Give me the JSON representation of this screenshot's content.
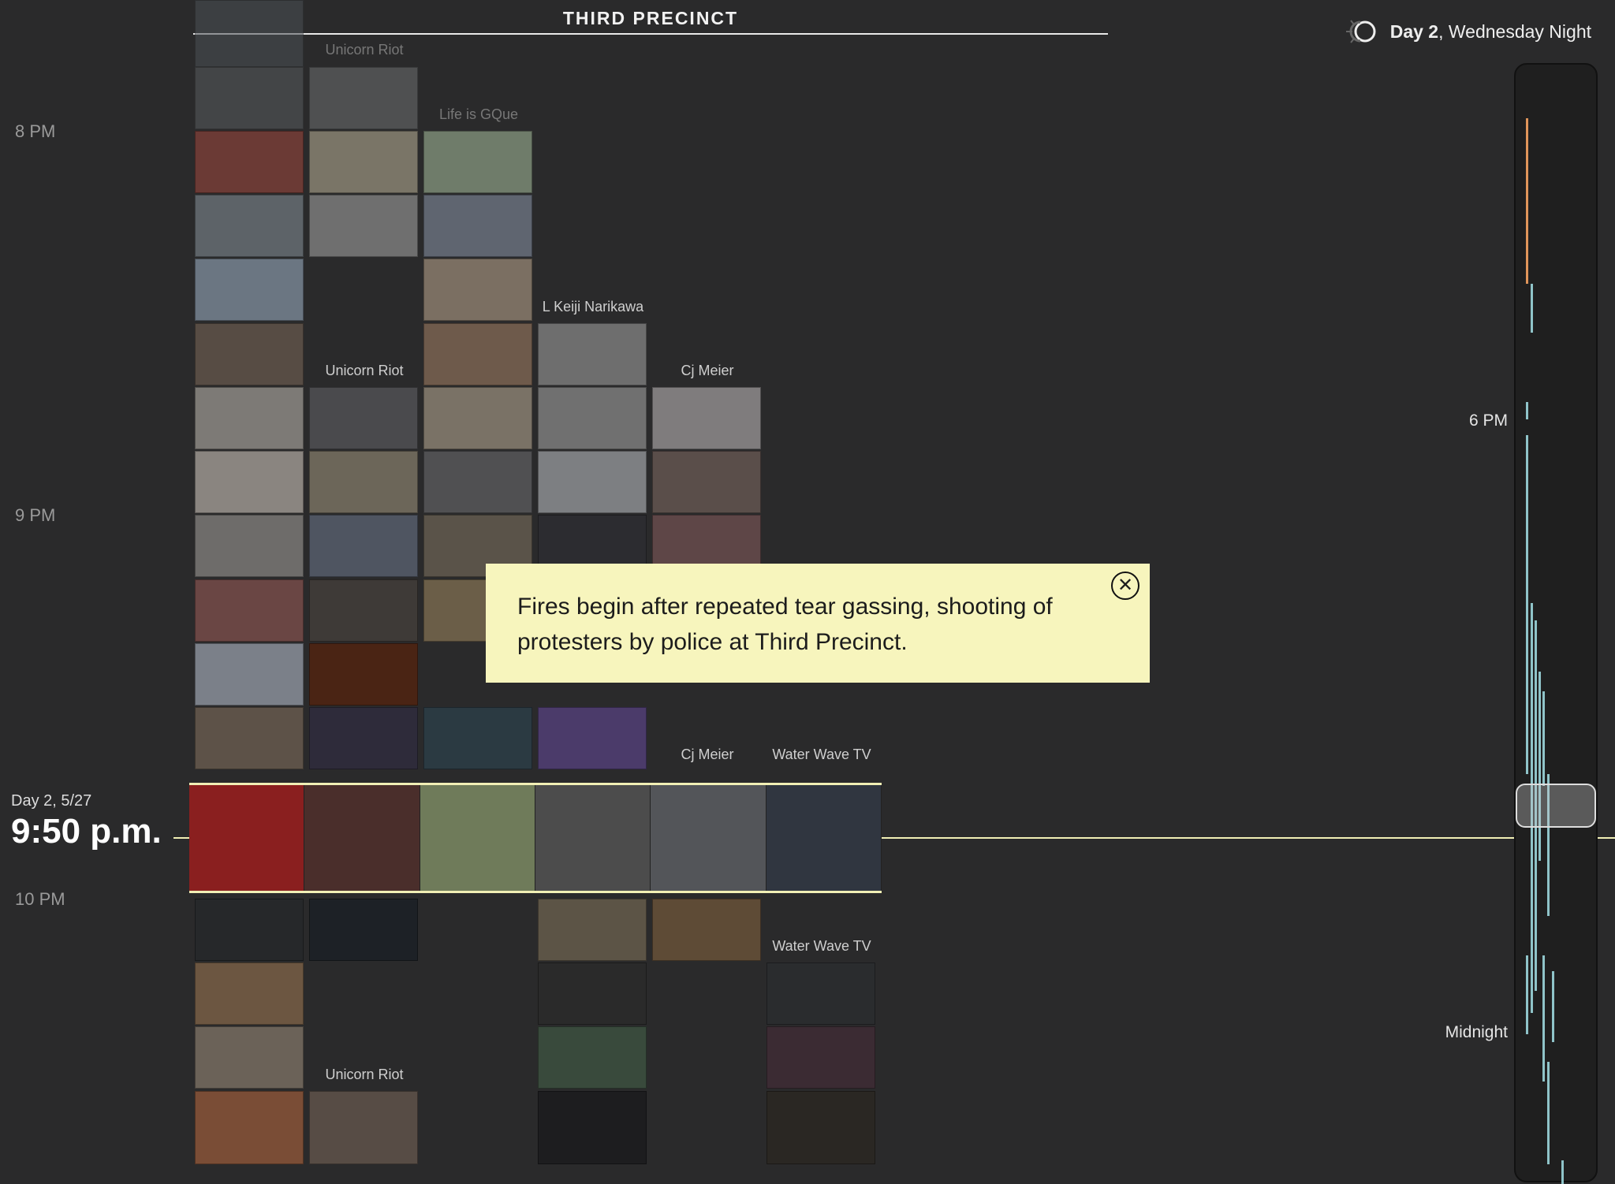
{
  "header": {
    "title": "THIRD PRECINCT"
  },
  "day": {
    "bold": "Day 2",
    "rest": ", Wednesday Night"
  },
  "time_axis": [
    "8 PM",
    "9 PM",
    "10 PM"
  ],
  "current": {
    "date": "Day 2, 5/27",
    "time": "9:50 p.m."
  },
  "sources": {
    "unicorn_1": "Unicorn Riot",
    "life_is_gque": "Life is GQue",
    "keiji": "L Keiji Narikawa",
    "unicorn_2": "Unicorn Riot",
    "cj_meier_1": "Cj Meier",
    "cj_meier_2": "Cj Meier",
    "water_wave_1": "Water Wave TV",
    "water_wave_2": "Water Wave TV",
    "unicorn_3": "Unicorn Riot"
  },
  "callout": {
    "text": "Fires begin after repeated tear gassing, shooting of protesters by police at Third Precinct.",
    "close": "✕"
  },
  "scrubber_labels": [
    "6 PM",
    "Midnight"
  ]
}
